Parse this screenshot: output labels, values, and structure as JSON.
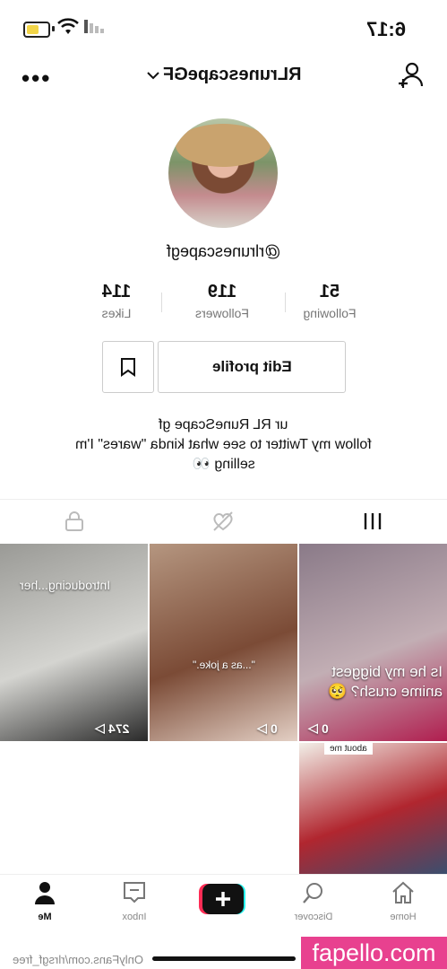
{
  "status_bar": {
    "time": "6:17"
  },
  "header": {
    "username": "RLrunescapeGF"
  },
  "profile": {
    "handle": "@rlrunescapegf",
    "stats": [
      {
        "value": "51",
        "label": "Following"
      },
      {
        "value": "119",
        "label": "Followers"
      },
      {
        "value": "114",
        "label": "Likes"
      }
    ],
    "edit_label": "Edit profile",
    "bio_lines": [
      "ur RL RuneScape gf",
      "follow my Twitter to see what kinda \"wares\" I'm",
      "selling 👀"
    ]
  },
  "videos": [
    {
      "caption": "Is he my biggest anime crush? 🥺",
      "views": "0",
      "colors": [
        "#8a7a88",
        "#c2aeb4",
        "#b01e4f"
      ]
    },
    {
      "caption": "\"...as a joke.\"",
      "views": "0",
      "colors": [
        "#b59680",
        "#7b4b36",
        "#e3cfc4"
      ]
    },
    {
      "caption": "Introducing...her",
      "views": "274",
      "colors": [
        "#9a9a96",
        "#d4d4d0",
        "#2a2a2a"
      ]
    },
    {
      "caption": "about me",
      "views": "",
      "colors": [
        "#f2efe8",
        "#b1262f",
        "#3b4e6e"
      ]
    }
  ],
  "bottom_nav": [
    {
      "label": "Home",
      "icon": "home-icon"
    },
    {
      "label": "Discover",
      "icon": "search-icon"
    },
    {
      "label": "",
      "icon": "plus-icon"
    },
    {
      "label": "Inbox",
      "icon": "inbox-icon"
    },
    {
      "label": "Me",
      "icon": "person-icon"
    }
  ],
  "watermarks": {
    "left": "OnlyFans.com/rlrsgf_free",
    "right": "fapello.com"
  },
  "colors": {
    "accent_pink": "#e8418f",
    "tiktok_cyan": "#25f4ee",
    "tiktok_red": "#fe2c55"
  }
}
